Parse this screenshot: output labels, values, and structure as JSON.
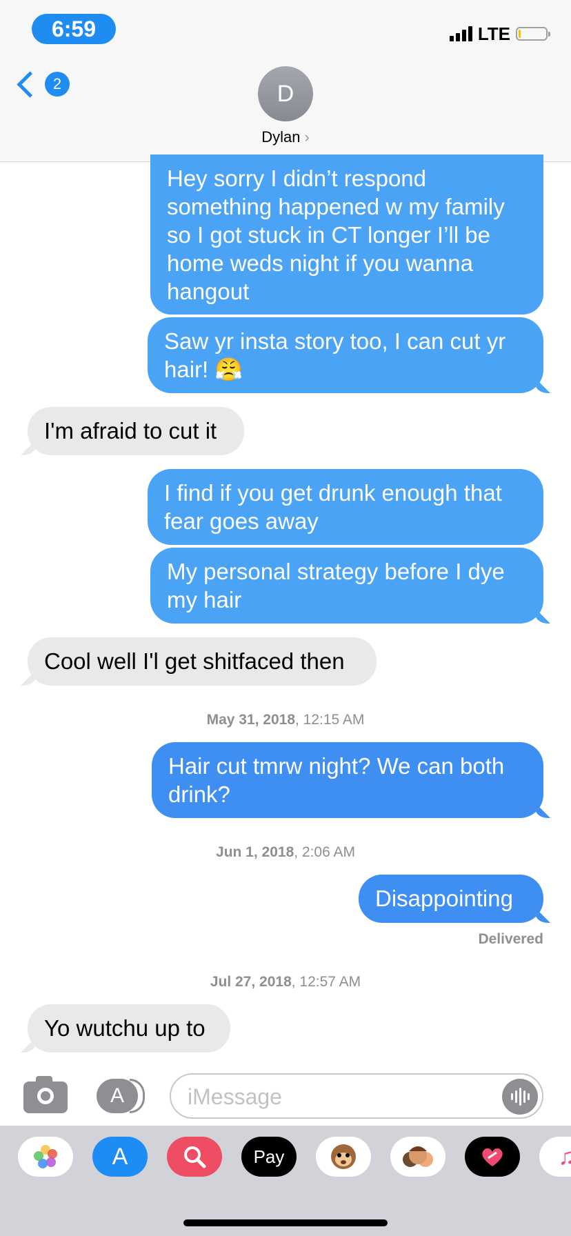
{
  "status_bar": {
    "time": "6:59",
    "network": "LTE"
  },
  "header": {
    "back_badge": "2",
    "avatar_initial": "D",
    "contact_name": "Dylan"
  },
  "messages": [
    {
      "type": "sent",
      "text": "Hey sorry I didn’t respond something happened w my family so I got stuck in CT longer I’ll be home weds night if you wanna hangout"
    },
    {
      "type": "sent",
      "text": "Saw yr insta story too, I can cut yr hair! 😤"
    },
    {
      "type": "received",
      "text": "I'm afraid to cut it"
    },
    {
      "type": "sent",
      "text": "I find if you get drunk enough that fear goes away"
    },
    {
      "type": "sent",
      "text": "My personal strategy before I dye my hair"
    },
    {
      "type": "received",
      "text": "Cool well I'l get shitfaced then"
    },
    {
      "type": "sent",
      "text": "Hair cut tmrw night? We can both drink?"
    },
    {
      "type": "sent",
      "text": "Disappointing"
    },
    {
      "type": "received",
      "text": "Yo wutchu up to"
    }
  ],
  "timestamps": [
    {
      "date": "May 31, 2018",
      "time": ", 12:15 AM"
    },
    {
      "date": "Jun 1, 2018",
      "time": ", 2:06 AM"
    },
    {
      "date": "Jul 27, 2018",
      "time": ", 12:57 AM"
    }
  ],
  "delivery_status": "Delivered",
  "input": {
    "placeholder": "iMessage"
  },
  "app_drawer": [
    {
      "icon": "photos-icon"
    },
    {
      "icon": "app-store-icon"
    },
    {
      "icon": "search-images-icon"
    },
    {
      "icon": "apple-pay-icon",
      "label": "Pay"
    },
    {
      "icon": "animoji-monkey-icon"
    },
    {
      "icon": "memoji-icon"
    },
    {
      "icon": "digital-touch-icon"
    },
    {
      "icon": "music-icon"
    }
  ],
  "colors": {
    "accent": "#1f8cf2",
    "sent_bubble": "#4aa3f5",
    "received_bubble": "#e9e9eb"
  }
}
